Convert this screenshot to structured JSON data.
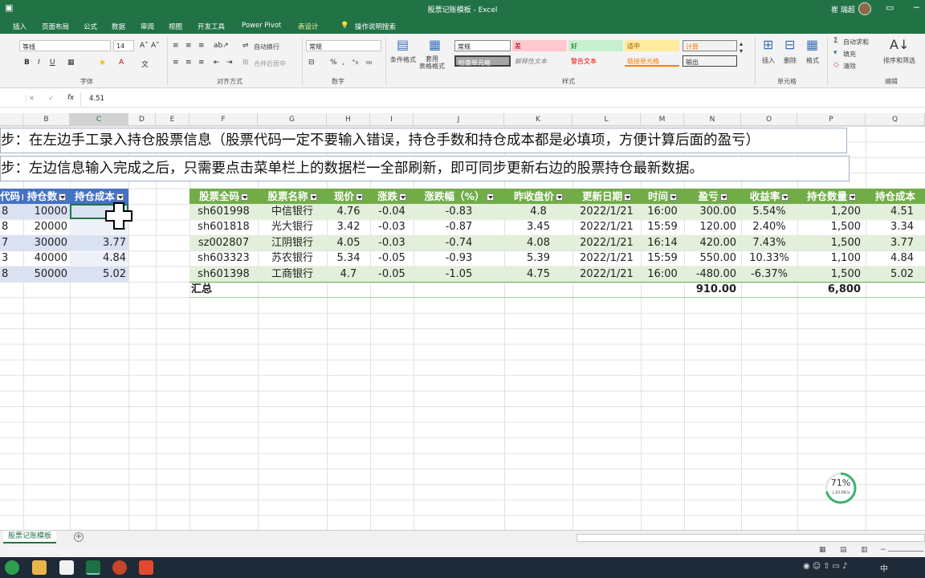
{
  "titlebar": {
    "title": "股票记账模板 - Excel",
    "user": "崔 瑞超"
  },
  "tabs": [
    "插入",
    "页面布局",
    "公式",
    "数据",
    "审阅",
    "视图",
    "开发工具",
    "Power Pivot",
    "表设计",
    "操作说明搜索"
  ],
  "ribbon": {
    "font_name": "等线",
    "font_size": "14",
    "wrap_text": "自动换行",
    "merge_center": "合并后居中",
    "number_format": "常规",
    "cond_format": "条件格式",
    "table_format": "套用\n表格格式",
    "styles": {
      "normal": "常规",
      "bad": "差",
      "good": "好",
      "neutral": "适中",
      "calc": "计算",
      "check": "检查单元格",
      "explain": "解释性文本",
      "warn": "警告文本",
      "linked": "链接单元格",
      "output": "输出"
    },
    "insert": "插入",
    "delete": "删除",
    "format": "格式",
    "autosum": "自动求和",
    "fill": "填充",
    "clear": "清除",
    "sort_filter": "排序和筛选",
    "groups": {
      "font": "字体",
      "align": "对齐方式",
      "number": "数字",
      "style": "样式",
      "cells": "单元格",
      "edit": "编辑"
    }
  },
  "formula_bar": {
    "value": "4.51"
  },
  "columns": [
    "B",
    "C",
    "D",
    "E",
    "F",
    "G",
    "H",
    "I",
    "J",
    "K",
    "L",
    "M",
    "N",
    "O",
    "P",
    "Q"
  ],
  "instructions": [
    "步：在左边手工录入持仓股票信息（股票代码一定不要输入错误，持仓手数和持仓成本都是必填项，方便计算后面的盈亏）",
    "步：左边信息输入完成之后，只需要点击菜单栏上的数据栏一全部刷新，即可同步更新右边的股票持仓最新数据。"
  ],
  "left_table": {
    "headers": [
      "代码",
      "持仓数",
      "持仓成本"
    ],
    "rows": [
      [
        "8",
        "10000",
        ""
      ],
      [
        "8",
        "20000",
        "3."
      ],
      [
        "7",
        "30000",
        "3.77"
      ],
      [
        "3",
        "40000",
        "4.84"
      ],
      [
        "8",
        "50000",
        "5.02"
      ]
    ]
  },
  "right_table": {
    "headers": [
      "股票全码",
      "股票名称",
      "现价",
      "涨跌",
      "涨跌幅（%）",
      "昨收盘价",
      "更新日期",
      "时间",
      "盈亏",
      "收益率",
      "持仓数量",
      "持仓成本"
    ],
    "rows": [
      [
        "sh601998",
        "中信银行",
        "4.76",
        "-0.04",
        "-0.83",
        "4.8",
        "2022/1/21",
        "16:00",
        "300.00",
        "5.54%",
        "1,200",
        "4.51"
      ],
      [
        "sh601818",
        "光大银行",
        "3.42",
        "-0.03",
        "-0.87",
        "3.45",
        "2022/1/21",
        "15:59",
        "120.00",
        "2.40%",
        "1,500",
        "3.34"
      ],
      [
        "sz002807",
        "江阴银行",
        "4.05",
        "-0.03",
        "-0.74",
        "4.08",
        "2022/1/21",
        "16:14",
        "420.00",
        "7.43%",
        "1,500",
        "3.77"
      ],
      [
        "sh603323",
        "苏农银行",
        "5.34",
        "-0.05",
        "-0.93",
        "5.39",
        "2022/1/21",
        "15:59",
        "550.00",
        "10.33%",
        "1,100",
        "4.84"
      ],
      [
        "sh601398",
        "工商银行",
        "4.7",
        "-0.05",
        "-1.05",
        "4.75",
        "2022/1/21",
        "16:00",
        "-480.00",
        "-6.37%",
        "1,500",
        "5.02"
      ]
    ],
    "total_label": "汇总",
    "total_pnl": "910.00",
    "total_qty": "6,800"
  },
  "sheet_tab": "股票记账模板",
  "progress": {
    "percent": "71%",
    "speed": "↓10.6K/s"
  },
  "colors": {
    "excel_green": "#217346",
    "table_header": "#70ad47",
    "band": "#e2efda",
    "left_band": "#d9e1f2",
    "left_header": "#4472c4"
  }
}
